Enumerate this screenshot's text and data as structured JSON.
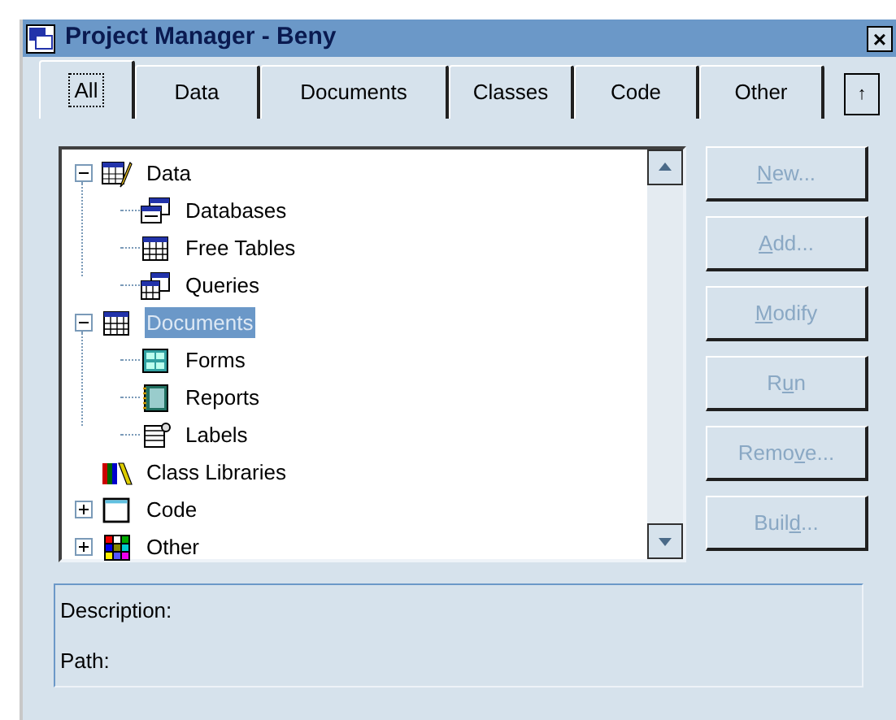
{
  "window": {
    "title": "Project Manager - Beny",
    "close": "×"
  },
  "tabs": [
    {
      "label": "All",
      "selected": true
    },
    {
      "label": "Data",
      "selected": false
    },
    {
      "label": "Documents",
      "selected": false
    },
    {
      "label": "Classes",
      "selected": false
    },
    {
      "label": "Code",
      "selected": false
    },
    {
      "label": "Other",
      "selected": false
    }
  ],
  "tab_scroll": "↑",
  "tree": [
    {
      "label": "Data",
      "kind": "data",
      "expanded": true,
      "selected": false,
      "children": [
        {
          "label": "Databases",
          "kind": "database",
          "selected": false
        },
        {
          "label": "Free Tables",
          "kind": "table",
          "selected": false
        },
        {
          "label": "Queries",
          "kind": "query",
          "selected": false
        }
      ]
    },
    {
      "label": "Documents",
      "kind": "table",
      "expanded": true,
      "selected": true,
      "children": [
        {
          "label": "Forms",
          "kind": "form",
          "selected": false
        },
        {
          "label": "Reports",
          "kind": "report",
          "selected": false
        },
        {
          "label": "Labels",
          "kind": "label",
          "selected": false
        }
      ]
    },
    {
      "label": "Class Libraries",
      "kind": "classlib",
      "selected": false
    },
    {
      "label": "Code",
      "kind": "code",
      "expanded": false,
      "selected": false
    },
    {
      "label": "Other",
      "kind": "other",
      "expanded": false,
      "selected": false
    }
  ],
  "buttons": [
    {
      "key": "N",
      "after": "ew...",
      "disabled": true
    },
    {
      "key": "A",
      "after": "dd...",
      "disabled": true
    },
    {
      "key": "M",
      "after": "odify",
      "disabled": true
    },
    {
      "before": "R",
      "key": "u",
      "after": "n",
      "disabled": true
    },
    {
      "before": "Remo",
      "key": "v",
      "after": "e...",
      "disabled": true
    },
    {
      "before": "Buil",
      "key": "d",
      "after": "...",
      "disabled": true
    }
  ],
  "info": {
    "description": "Description:",
    "path": "Path:"
  }
}
